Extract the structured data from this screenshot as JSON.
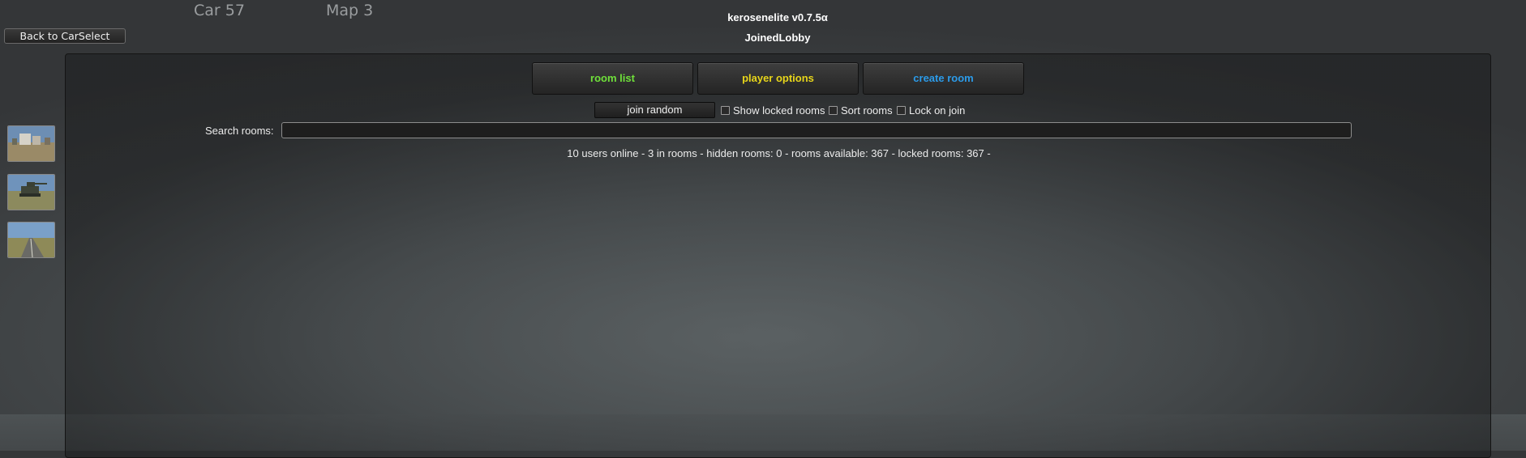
{
  "header": {
    "car_label": "Car 57",
    "map_label": "Map 3",
    "app_title": "kerosenelite v0.7.5α",
    "status": "JoinedLobby",
    "back_button": "Back to CarSelect"
  },
  "tabs": [
    {
      "label": "room list",
      "color": "#6fe03a"
    },
    {
      "label": "player options",
      "color": "#e7d51a"
    },
    {
      "label": "create room",
      "color": "#2b9be9"
    }
  ],
  "controls": {
    "join_random": "join random",
    "show_locked_rooms": "Show locked rooms",
    "sort_rooms": "Sort rooms",
    "lock_on_join": "Lock on join",
    "search_label": "Search rooms:",
    "search_value": ""
  },
  "stats": "10 users online - 3 in rooms - hidden rooms: 0 - rooms available: 367 - locked rooms: 367 -",
  "thumbnails": [
    "farm-buildings-thumbnail",
    "tank-thumbnail",
    "road-thumbnail"
  ]
}
